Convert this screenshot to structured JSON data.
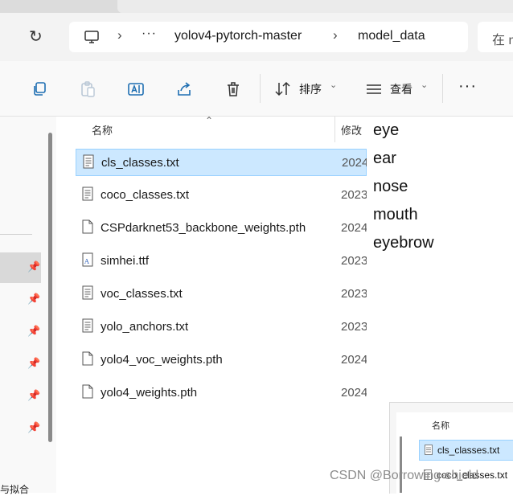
{
  "address_bar": {
    "more_label": "···",
    "crumbs": [
      "yolov4-pytorch-master",
      "model_data"
    ],
    "search_placeholder": "在 m"
  },
  "toolbar": {
    "sort_label": "排序",
    "view_label": "查看",
    "more_label": "···"
  },
  "nav": {
    "truncated_text": "与拟合"
  },
  "file_list": {
    "header_name": "名称",
    "header_date": "修改",
    "files": [
      {
        "name": "cls_classes.txt",
        "date": "2024",
        "type": "text",
        "selected": true
      },
      {
        "name": "coco_classes.txt",
        "date": "2023",
        "type": "text",
        "selected": false
      },
      {
        "name": "CSPdarknet53_backbone_weights.pth",
        "date": "2024",
        "type": "file",
        "selected": false
      },
      {
        "name": "simhei.ttf",
        "date": "2023",
        "type": "font",
        "selected": false
      },
      {
        "name": "voc_classes.txt",
        "date": "2023",
        "type": "text",
        "selected": false
      },
      {
        "name": "yolo_anchors.txt",
        "date": "2023",
        "type": "text",
        "selected": false
      },
      {
        "name": "yolo4_voc_weights.pth",
        "date": "2024",
        "type": "file",
        "selected": false
      },
      {
        "name": "yolo4_weights.pth",
        "date": "2024",
        "type": "file",
        "selected": false
      }
    ]
  },
  "text_content": {
    "lines": [
      "eye",
      "ear",
      "nose",
      "mouth",
      "eyebrow"
    ]
  },
  "mini_window": {
    "header_name": "名称",
    "files": [
      "cls_classes.txt",
      "coco_classes.txt"
    ]
  },
  "watermark": "CSDN @Borrowing-shield"
}
